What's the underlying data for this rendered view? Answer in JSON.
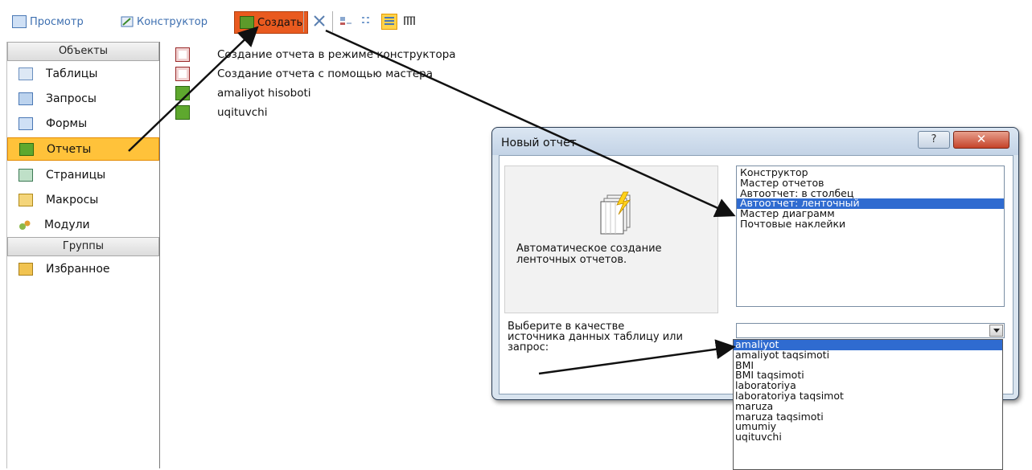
{
  "toolbar": {
    "preview_label": "Просмотр",
    "design_label": "Конструктор",
    "create_label": "Создать"
  },
  "left_panel": {
    "objects_header": "Объекты",
    "items": [
      {
        "label": "Таблицы",
        "icon": "table-icon"
      },
      {
        "label": "Запросы",
        "icon": "query-icon"
      },
      {
        "label": "Формы",
        "icon": "form-icon"
      },
      {
        "label": "Отчеты",
        "icon": "report-icon",
        "selected": true
      },
      {
        "label": "Страницы",
        "icon": "page-icon"
      },
      {
        "label": "Макросы",
        "icon": "macro-icon"
      },
      {
        "label": "Модули",
        "icon": "module-icon"
      }
    ],
    "groups_header": "Группы",
    "favorites_label": "Избранное"
  },
  "file_list": [
    "Создание отчета в режиме конструктора",
    "Создание отчета с помощью мастера",
    "amaliyot hisoboti",
    "uqituvchi"
  ],
  "dialog": {
    "title": "Новый отчет",
    "help_label": "?",
    "close_label": "✕",
    "preview_description": "Автоматическое создание\nленточных отчетов.",
    "report_types": [
      "Конструктор",
      "Мастер отчетов",
      "Автоотчет: в столбец",
      "Автоотчет: ленточный",
      "Мастер диаграмм",
      "Почтовые наклейки"
    ],
    "selected_report_type": "Автоотчет: ленточный",
    "source_label": "Выберите в качестве\nисточника данных таблицу или\nзапрос:",
    "source_value": ""
  },
  "dropdown": {
    "items": [
      "amaliyot",
      "amaliyot taqsimoti",
      "BMI",
      "BMI taqsimoti",
      "laboratoriya",
      "laboratoriya taqsimot",
      "maruza",
      "maruza taqsimoti",
      "umumiy",
      "uqituvchi"
    ],
    "selected": "amaliyot"
  },
  "colors": {
    "selection_blue": "#2f6bd0",
    "create_button_orange": "#e95a1f",
    "selected_item_orange": "#ffc23a"
  }
}
